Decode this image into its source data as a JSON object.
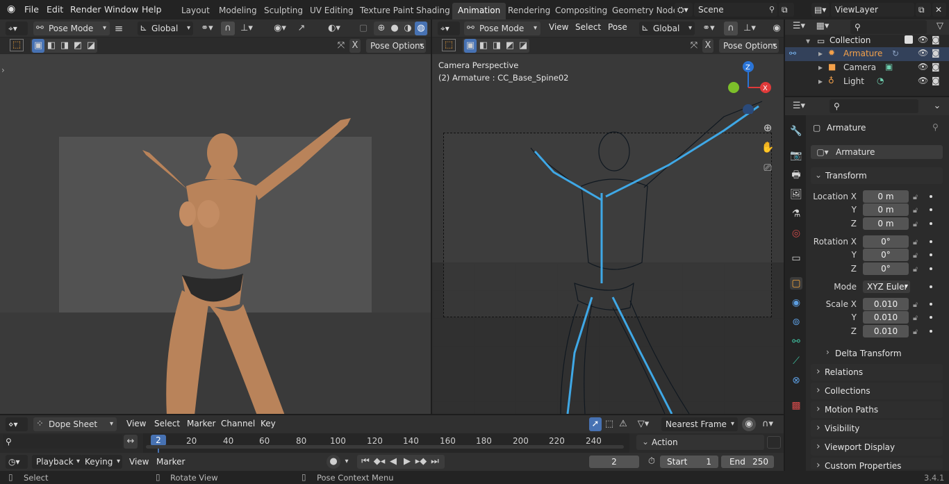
{
  "topbar": {
    "menus": [
      "File",
      "Edit",
      "Render",
      "Window",
      "Help"
    ],
    "workspaces": [
      "Layout",
      "Modeling",
      "Sculpting",
      "UV Editing",
      "Texture Paint",
      "Shading",
      "Animation",
      "Rendering",
      "Compositing",
      "Geometry Node"
    ],
    "active_workspace": "Animation",
    "scene": "Scene",
    "view_layer": "ViewLayer"
  },
  "left_viewport": {
    "mode": "Pose Mode",
    "orientation": "Global",
    "pose_options": "Pose Options"
  },
  "right_viewport": {
    "mode": "Pose Mode",
    "menus": [
      "View",
      "Select",
      "Pose"
    ],
    "orientation": "Global",
    "pose_options": "Pose Options",
    "camera_label": "Camera Perspective",
    "object_label": "(2) Armature : CC_Base_Spine02"
  },
  "outliner": {
    "collection": "Collection",
    "items": [
      {
        "name": "Armature",
        "selected": true
      },
      {
        "name": "Camera",
        "selected": false
      },
      {
        "name": "Light",
        "selected": false
      }
    ]
  },
  "properties": {
    "object_name": "Armature",
    "data_name": "Armature",
    "transform_title": "Transform",
    "location_label": "Location X",
    "rotation_label": "Rotation X",
    "scale_label": "Scale X",
    "y_label": "Y",
    "z_label": "Z",
    "location": [
      "0 m",
      "0 m",
      "0 m"
    ],
    "rotation": [
      "0°",
      "0°",
      "0°"
    ],
    "mode_label": "Mode",
    "mode_value": "XYZ Euler",
    "scale": [
      "0.010",
      "0.010",
      "0.010"
    ],
    "delta_transform": "Delta Transform",
    "sections": [
      "Relations",
      "Collections",
      "Motion Paths",
      "Visibility",
      "Viewport Display",
      "Custom Properties"
    ]
  },
  "dopesheet": {
    "editor": "Dope Sheet",
    "menus": [
      "View",
      "Select",
      "Marker",
      "Channel",
      "Key"
    ],
    "snap": "Nearest Frame",
    "action_label": "Action",
    "current_frame_badge": "2",
    "ticks": [
      "20",
      "40",
      "60",
      "80",
      "100",
      "120",
      "140",
      "160",
      "180",
      "200",
      "220",
      "240"
    ]
  },
  "timeline": {
    "menus": [
      "Playback",
      "Keying",
      "View",
      "Marker"
    ],
    "current_frame": "2",
    "start_label": "Start",
    "start_value": "1",
    "end_label": "End",
    "end_value": "250"
  },
  "statusbar": {
    "items": [
      "Select",
      "Rotate View",
      "Pose Context Menu"
    ],
    "version": "3.4.1"
  },
  "colors": {
    "accent": "#4772b3",
    "selected_text": "#f4a14a",
    "bone_blue": "#3fa8e6",
    "axis_x": "#e03a3a",
    "axis_y": "#7cbf2a",
    "axis_z": "#2a74d6"
  }
}
